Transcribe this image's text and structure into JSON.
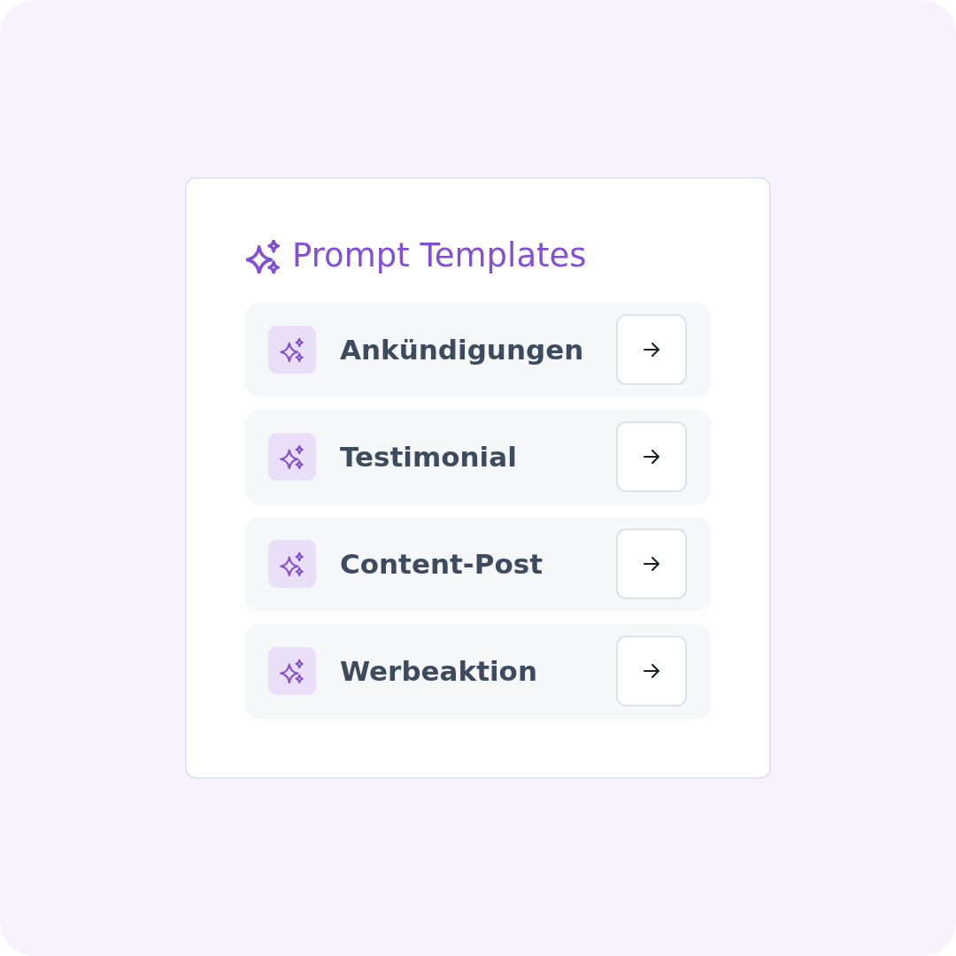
{
  "panel": {
    "title": "Prompt Templates"
  },
  "templates": [
    {
      "label": "Ankündigungen"
    },
    {
      "label": "Testimonial"
    },
    {
      "label": "Content-Post"
    },
    {
      "label": "Werbeaktion"
    }
  ]
}
